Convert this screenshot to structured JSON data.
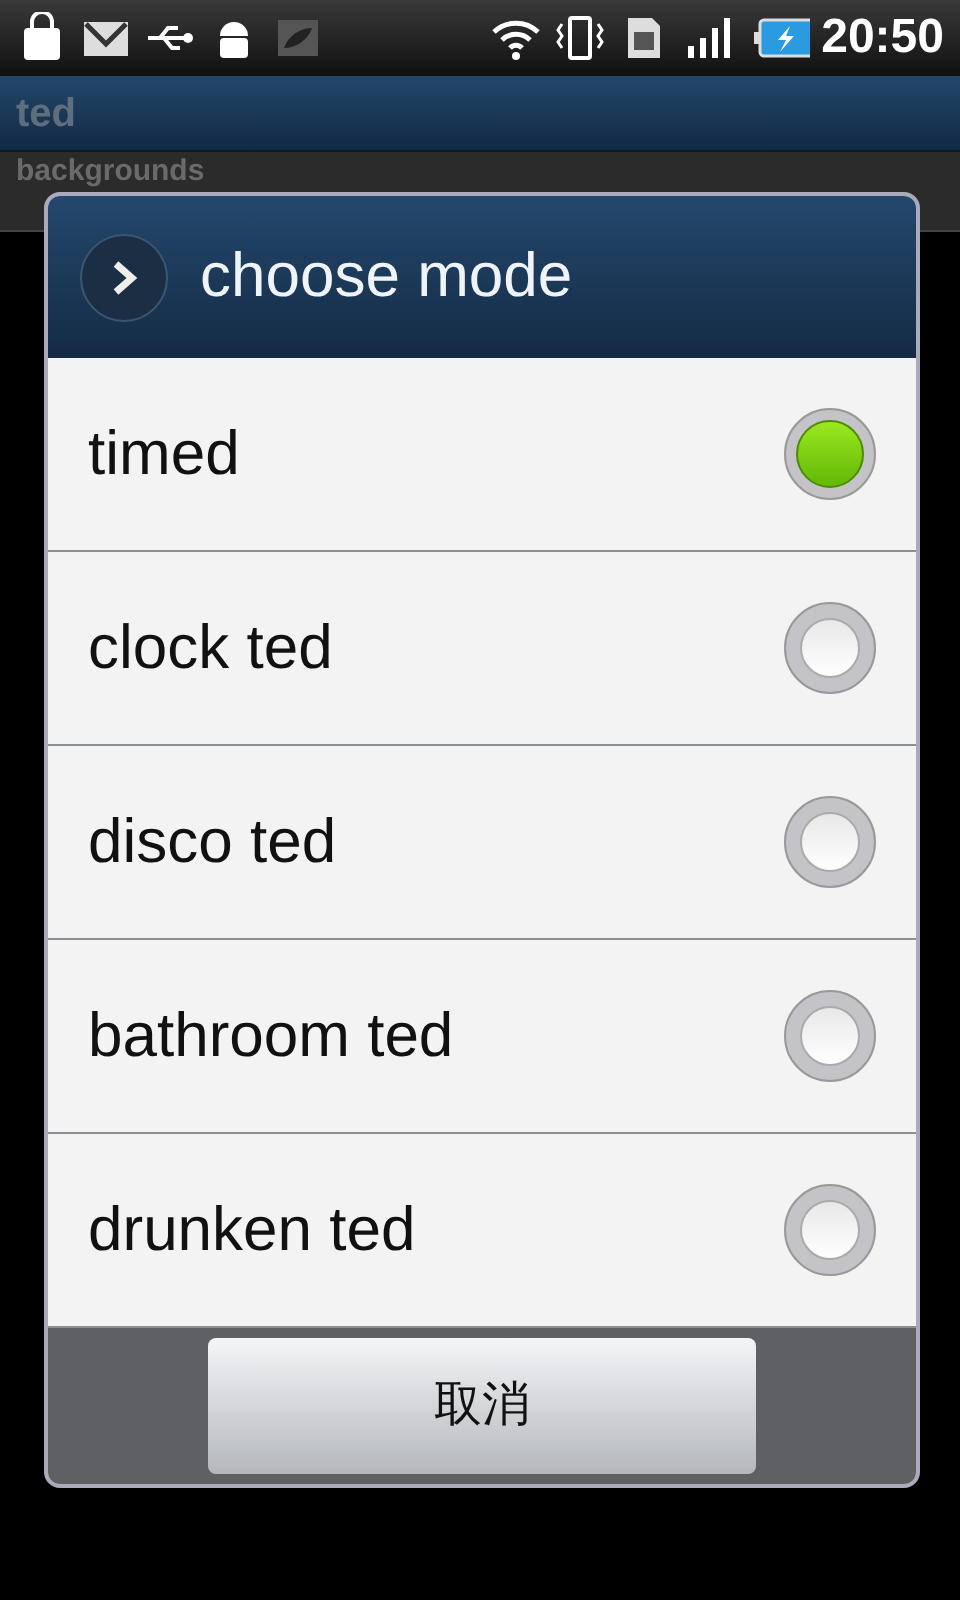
{
  "status_bar": {
    "time": "20:50"
  },
  "app_bar": {
    "title": "ted"
  },
  "list": [
    {
      "label": "backgrounds"
    }
  ],
  "dialog": {
    "title": "choose mode",
    "options": [
      {
        "label": "timed",
        "selected": true
      },
      {
        "label": "clock ted",
        "selected": false
      },
      {
        "label": "disco ted",
        "selected": false
      },
      {
        "label": "bathroom ted",
        "selected": false
      },
      {
        "label": "drunken ted",
        "selected": false
      }
    ],
    "cancel_button": "取消"
  }
}
